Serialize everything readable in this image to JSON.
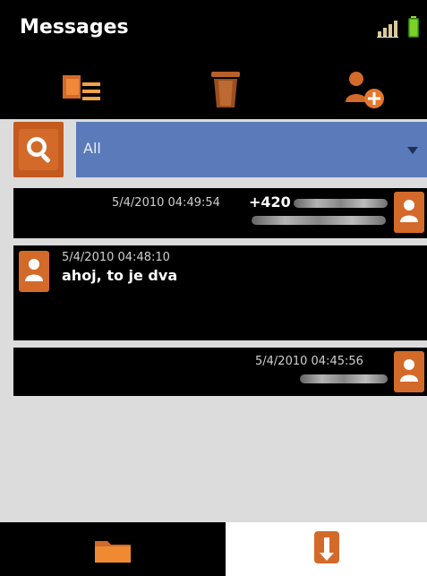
{
  "app": {
    "title": "Messages"
  },
  "toolbar": {
    "icons": [
      "move-to-folder-icon",
      "trash-icon",
      "add-contact-icon"
    ]
  },
  "filter": {
    "selected": "All"
  },
  "messages": [
    {
      "timestamp": "5/4/2010 04:49:54",
      "sender": "+420",
      "preview": ""
    },
    {
      "timestamp": "5/4/2010 04:48:10",
      "sender": "",
      "preview": "ahoj, to je dva"
    },
    {
      "timestamp": "5/4/2010 04:45:56",
      "sender": "",
      "preview": ""
    }
  ],
  "bottom_tabs": {
    "left_icon": "folder-icon",
    "right_icon": "alert-icon"
  },
  "colors": {
    "accent_orange": "#d36a2a",
    "filter_blue": "#5a7ab9",
    "background": "#dcdcdc",
    "bar_black": "#000000"
  }
}
